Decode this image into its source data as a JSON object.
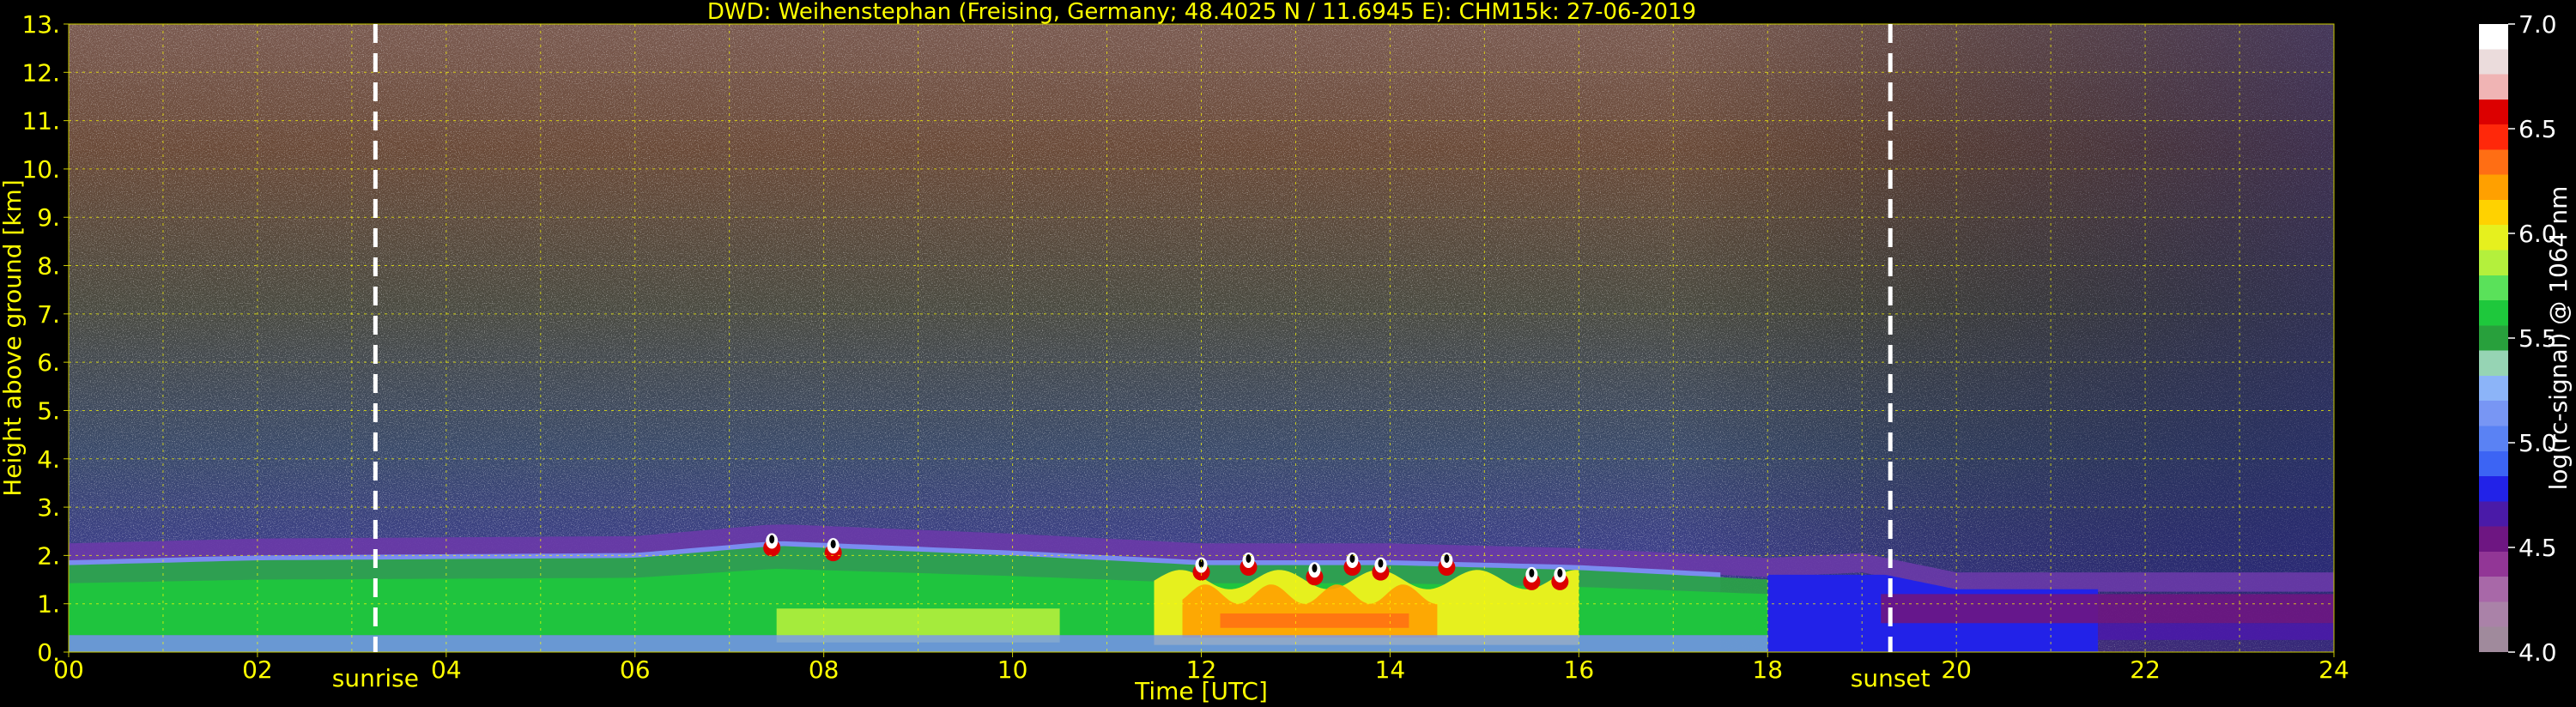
{
  "chart_data": {
    "type": "heatmap",
    "title": "DWD: Weihenstephan (Freising, Germany; 48.4025 N / 11.6945 E):    CHM15k: 27-06-2019",
    "xlabel": "Time [UTC]",
    "ylabel": "Height above ground [km]",
    "xlim": [
      0,
      24
    ],
    "ylim": [
      0,
      13
    ],
    "x_ticks": [
      "00",
      "02",
      "04",
      "06",
      "08",
      "10",
      "12",
      "14",
      "16",
      "18",
      "20",
      "22",
      "24"
    ],
    "y_ticks": [
      "0.",
      "1.",
      "2.",
      "3.",
      "4.",
      "5.",
      "6.",
      "7.",
      "8.",
      "9.",
      "10.",
      "11.",
      "12.",
      "13."
    ],
    "grid": true,
    "grid_color": "#ffff00",
    "colorbar": {
      "label": "log(rc-signal) @ 1064 nm",
      "range": [
        4.0,
        7.0
      ],
      "ticks": [
        "4.0",
        "4.5",
        "5.0",
        "5.5",
        "6.0",
        "6.5",
        "7.0"
      ],
      "colors": [
        "#a08a9c",
        "#aa82a8",
        "#a868a8",
        "#923696",
        "#6e1682",
        "#4a1aa8",
        "#2222e8",
        "#3c64f4",
        "#5a82f4",
        "#7896f4",
        "#8cb4f8",
        "#96d4b4",
        "#28a03c",
        "#1ec83c",
        "#5ae15a",
        "#b4f03c",
        "#e6f01e",
        "#ffd200",
        "#ffa000",
        "#ff6e14",
        "#ff280a",
        "#dc0000",
        "#f0b4b4",
        "#ebdcdc",
        "#ffffff"
      ]
    },
    "annotations": [
      {
        "label": "sunrise",
        "x": 3.25
      },
      {
        "label": "sunset",
        "x": 19.3
      }
    ],
    "layers": {
      "boundary_layer_top_km": [
        [
          0,
          1.9
        ],
        [
          2,
          2.0
        ],
        [
          6,
          2.05
        ],
        [
          7.5,
          2.3
        ],
        [
          10,
          2.1
        ],
        [
          12,
          1.9
        ],
        [
          14,
          1.9
        ],
        [
          16,
          1.8
        ],
        [
          18,
          1.6
        ],
        [
          19,
          1.7
        ],
        [
          20,
          1.3
        ],
        [
          24,
          1.3
        ]
      ],
      "cloud_tops_km": [
        [
          7.45,
          2.3
        ],
        [
          8.1,
          2.2
        ],
        [
          12.0,
          1.8
        ],
        [
          12.5,
          1.9
        ],
        [
          13.2,
          1.7
        ],
        [
          13.6,
          1.9
        ],
        [
          13.9,
          1.8
        ],
        [
          14.6,
          1.9
        ],
        [
          15.5,
          1.6
        ],
        [
          15.8,
          1.6
        ]
      ],
      "peak_signal_window_utc": [
        11.5,
        14.5
      ]
    },
    "background_color": "#000000"
  }
}
